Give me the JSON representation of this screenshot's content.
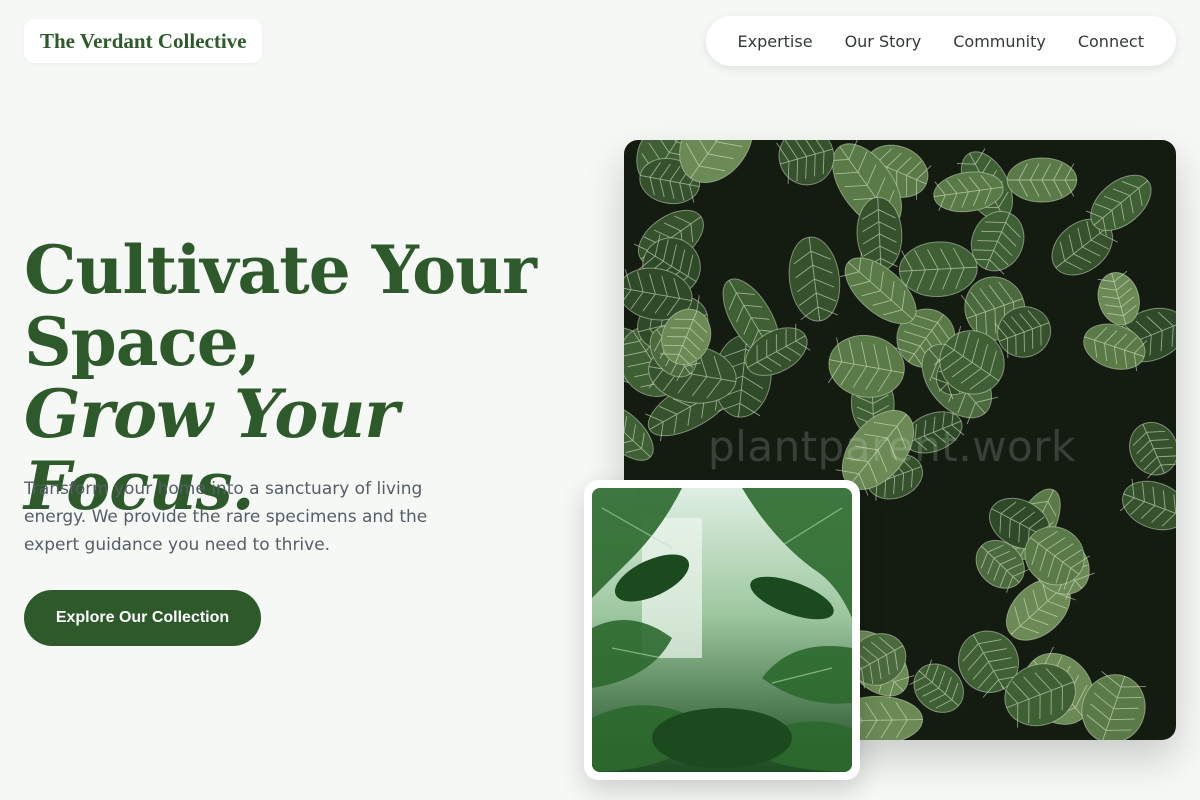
{
  "brand": {
    "name": "The Verdant Collective"
  },
  "nav": {
    "items": [
      {
        "label": "Expertise"
      },
      {
        "label": "Our Story"
      },
      {
        "label": "Community"
      },
      {
        "label": "Connect"
      }
    ]
  },
  "hero": {
    "headline_line1": "Cultivate Your",
    "headline_line2": "Space,",
    "headline_line3": "Grow Your Focus.",
    "subcopy": "Transform your home into a sanctuary of living energy. We provide the rare specimens and the expert guidance you need to thrive.",
    "cta_label": "Explore Our Collection"
  },
  "images": {
    "main": {
      "subject": "fittonia-leaves-photo",
      "watermark": "plantparent.work"
    },
    "secondary": {
      "subject": "tropical-greenhouse-photo"
    }
  },
  "colors": {
    "brand_green": "#2e5a2b",
    "background": "#f5f8f5",
    "body_text": "#555e66"
  }
}
